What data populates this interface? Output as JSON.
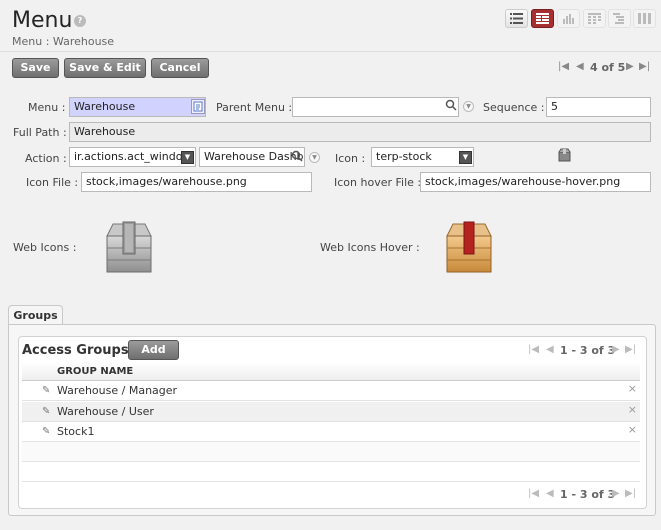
{
  "header": {
    "title": "Menu",
    "help": "?",
    "breadcrumb": "Menu : Warehouse"
  },
  "view_switcher": [
    "list-view-icon",
    "form-view-icon",
    "graph-view-icon",
    "calendar-view-icon",
    "gantt-view-icon",
    "kanban-view-icon"
  ],
  "toolbar": {
    "save_label": "Save",
    "save_edit_label": "Save & Edit",
    "cancel_label": "Cancel",
    "pager": "4 of 5"
  },
  "form": {
    "menu_label": "Menu :",
    "menu_value": "Warehouse",
    "parent_menu_label": "Parent Menu :",
    "parent_menu_value": "",
    "sequence_label": "Sequence :",
    "sequence_value": "5",
    "full_path_label": "Full Path :",
    "full_path_value": "Warehouse",
    "action_label": "Action :",
    "action_type_value": "ir.actions.act_window",
    "action_value": "Warehouse Dashb",
    "icon_label": "Icon :",
    "icon_value": "terp-stock",
    "icon_file_label": "Icon File :",
    "icon_file_value": "stock,images/warehouse.png",
    "icon_hover_file_label": "Icon hover File :",
    "icon_hover_file_value": "stock,images/warehouse-hover.png",
    "web_icons_label": "Web Icons :",
    "web_icons_hover_label": "Web Icons Hover :"
  },
  "tabs": [
    {
      "label": "Groups"
    }
  ],
  "groups": {
    "title": "Access Groups",
    "add_label": "Add",
    "pager": "1 - 3 of 3",
    "column_header": "GROUP NAME",
    "rows": [
      "Warehouse / Manager",
      "Warehouse / User",
      "Stock1"
    ],
    "delete_glyph": "×"
  },
  "colors": {
    "accent": "#a82f2f",
    "required_bg": "#d2d2ff",
    "button": "#7f7f7f"
  }
}
